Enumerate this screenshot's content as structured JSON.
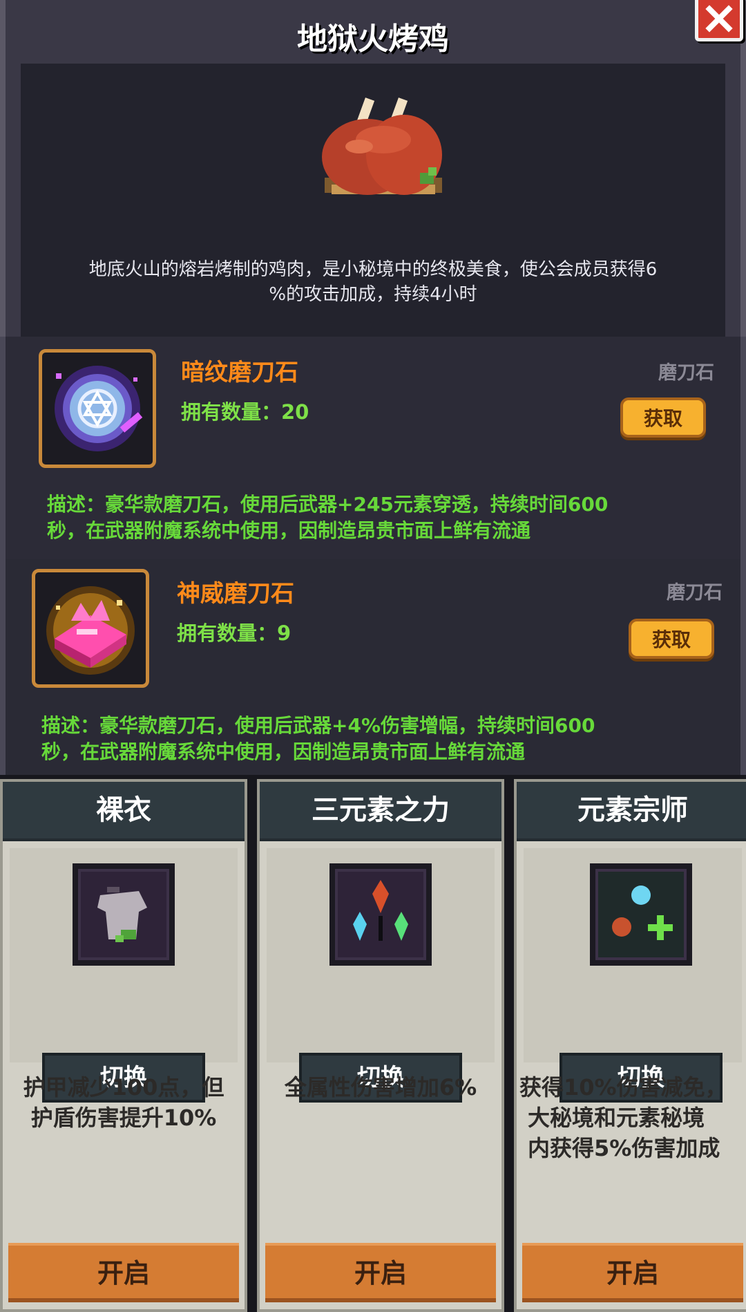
{
  "dialog": {
    "title": "地狱火烤鸡",
    "close_icon": "close-x-icon",
    "food_icon": "roast-chicken-icon",
    "description_line1": "地底火山的熔岩烤制的鸡肉，是小秘境中的终极美食，使公会成员获得6",
    "description_line2": "%的攻击加成，持续4小时"
  },
  "items": [
    {
      "name": "暗纹磨刀石",
      "count_label": "拥有数量：20",
      "category": "磨刀石",
      "button": "获取",
      "icon": "dark-pattern-whetstone-icon",
      "desc_line1": "描述：豪华款磨刀石，使用后武器+245元素穿透，持续时间600",
      "desc_line2": "秒，在武器附魔系统中使用，因制造昂贵市面上鲜有流通"
    },
    {
      "name": "神威磨刀石",
      "count_label": "拥有数量：9",
      "category": "磨刀石",
      "button": "获取",
      "icon": "divine-might-whetstone-icon",
      "desc_line1": "描述：豪华款磨刀石，使用后武器+4%伤害增幅，持续时间600",
      "desc_line2": "秒，在武器附魔系统中使用，因制造昂贵市面上鲜有流通"
    }
  ],
  "cards": [
    {
      "title": "裸衣",
      "icon": "bare-armor-icon",
      "switch": "切换",
      "desc_line1": "护甲减少100点，但",
      "desc_line2": "护盾伤害提升10%",
      "desc_line3": "",
      "open": "开启"
    },
    {
      "title": "三元素之力",
      "icon": "three-elements-icon",
      "switch": "切换",
      "desc_line1": "全属性伤害增加6%",
      "desc_line2": "",
      "desc_line3": "",
      "open": "开启"
    },
    {
      "title": "元素宗师",
      "icon": "element-master-icon",
      "switch": "切换",
      "desc_line1": "获得10%伤害减免，",
      "desc_line2": "大秘境和元素秘境",
      "desc_line3": "内获得5%伤害加成",
      "open": "开启"
    }
  ],
  "colors": {
    "item_name": "#ff8a1a",
    "item_count": "#7ee048",
    "item_desc": "#67d93a",
    "get_button": "#f7b12f",
    "open_button": "#d57c33",
    "card_header": "#2f3a40"
  }
}
